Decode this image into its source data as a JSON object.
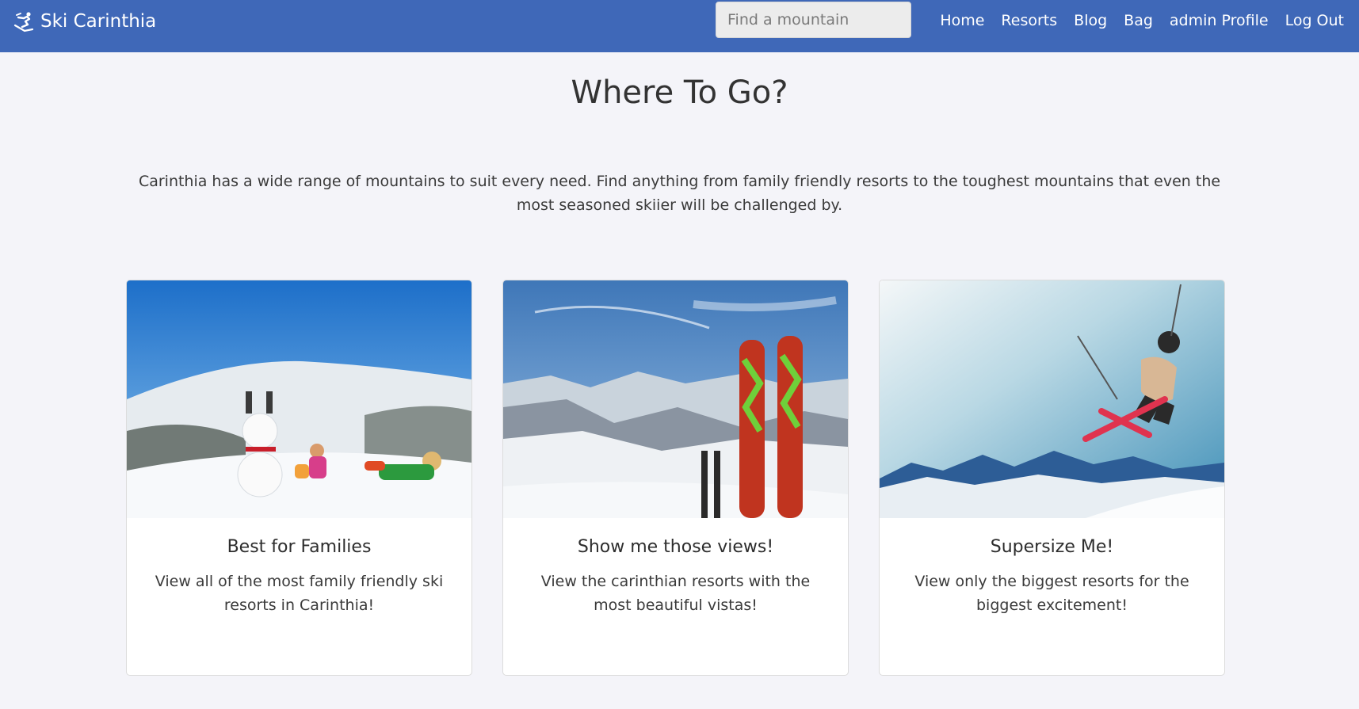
{
  "navbar": {
    "brand": "Ski Carinthia",
    "brand_icon": "skier-icon",
    "search_placeholder": "Find a mountain",
    "links": [
      "Home",
      "Resorts",
      "Blog",
      "Bag",
      "admin Profile",
      "Log Out"
    ],
    "background_color": "#3f68b8"
  },
  "main": {
    "title": "Where To Go?",
    "intro": "Carinthia has a wide range of mountains to suit every need. Find anything from family friendly resorts to the toughest mountains that even the most seasoned skiier will be challenged by."
  },
  "cards": [
    {
      "title": "Best for Families",
      "text": "View all of the most family friendly ski resorts in Carinthia!",
      "image": "family-snowman-photo"
    },
    {
      "title": "Show me those views!",
      "text": "View the carinthian resorts with the most beautiful vistas!",
      "image": "skis-mountain-view-photo"
    },
    {
      "title": "Supersize Me!",
      "text": "View only the biggest resorts for the biggest excitement!",
      "image": "freestyle-skier-jump-photo"
    }
  ]
}
